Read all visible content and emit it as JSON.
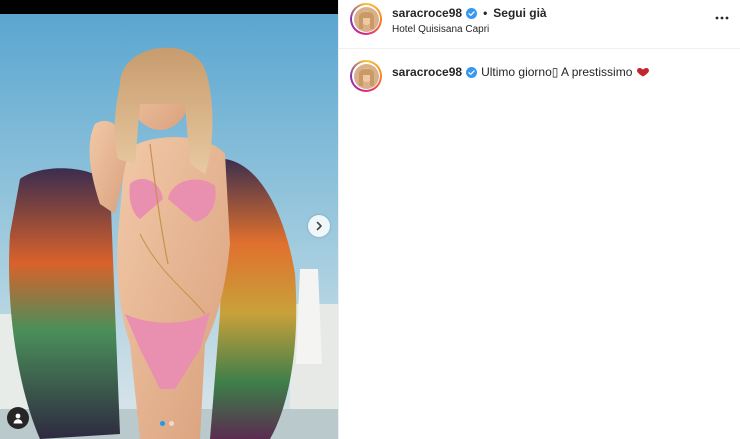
{
  "post": {
    "username": "saracroce98",
    "follow_label": "Segui già",
    "separator": "•",
    "location": "Hotel Quisisana Capri",
    "caption_text": "Ultimo giorno▯ A prestissimo",
    "media_count": 2,
    "media_current": 1
  },
  "icons": {
    "verified": "verified-badge-icon",
    "more": "more-options-icon",
    "next": "chevron-right-icon",
    "tags": "user-tag-icon",
    "emoji": "red-heart-emoji-icon"
  },
  "colors": {
    "verified_blue": "#3897f0",
    "text": "#262626",
    "active_dot": "#1a9bf0",
    "sky": "#7fb5cf"
  }
}
